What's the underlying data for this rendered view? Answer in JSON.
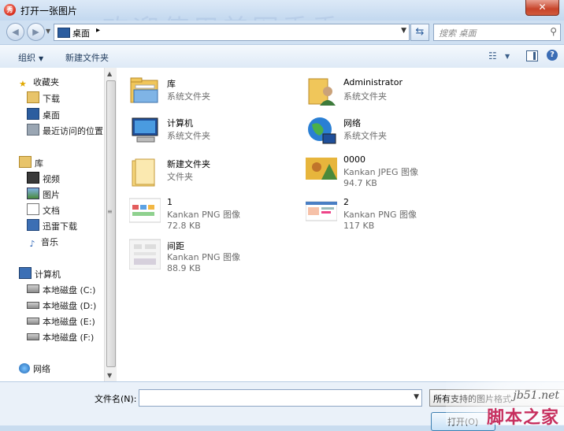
{
  "window": {
    "title": "打开一张图片",
    "close_glyph": "✕",
    "watermark": "欢迎使用美图秀秀"
  },
  "address": {
    "location": "桌面",
    "separator": "▸",
    "search_placeholder": "搜索 桌面"
  },
  "toolbar": {
    "organize": "组织",
    "new_folder": "新建文件夹"
  },
  "nav": {
    "favorites": "收藏夹",
    "favorites_items": [
      "下载",
      "桌面",
      "最近访问的位置"
    ],
    "libraries": "库",
    "library_items": [
      "视频",
      "图片",
      "文档",
      "迅雷下载",
      "音乐"
    ],
    "computer": "计算机",
    "drives": [
      "本地磁盘 (C:)",
      "本地磁盘 (D:)",
      "本地磁盘 (E:)",
      "本地磁盘 (F:)"
    ],
    "network": "网络"
  },
  "files": [
    {
      "name": "库",
      "line2": "系统文件夹",
      "line3": "",
      "icon": "library-icon"
    },
    {
      "name": "Administrator",
      "line2": "系统文件夹",
      "line3": "",
      "icon": "user-folder-icon"
    },
    {
      "name": "计算机",
      "line2": "系统文件夹",
      "line3": "",
      "icon": "computer-icon"
    },
    {
      "name": "网络",
      "line2": "系统文件夹",
      "line3": "",
      "icon": "network-icon"
    },
    {
      "name": "新建文件夹",
      "line2": "文件夹",
      "line3": "",
      "icon": "folder-icon"
    },
    {
      "name": "0000",
      "line2": "Kankan JPEG 图像",
      "line3": "94.7 KB",
      "icon": "jpeg-thumbnail"
    },
    {
      "name": "1",
      "line2": "Kankan PNG 图像",
      "line3": "72.8 KB",
      "icon": "png-thumbnail"
    },
    {
      "name": "2",
      "line2": "Kankan PNG 图像",
      "line3": "117 KB",
      "icon": "png-thumbnail"
    },
    {
      "name": "间距",
      "line2": "Kankan PNG 图像",
      "line3": "88.9 KB",
      "icon": "png-thumbnail"
    }
  ],
  "bottom": {
    "filename_label": "文件名(N):",
    "filename_value": "",
    "filter": "所有支持的图片格式",
    "open_button": "打开(O)"
  },
  "site_watermark": {
    "url": "jb51.net",
    "name": "脚本之家"
  }
}
